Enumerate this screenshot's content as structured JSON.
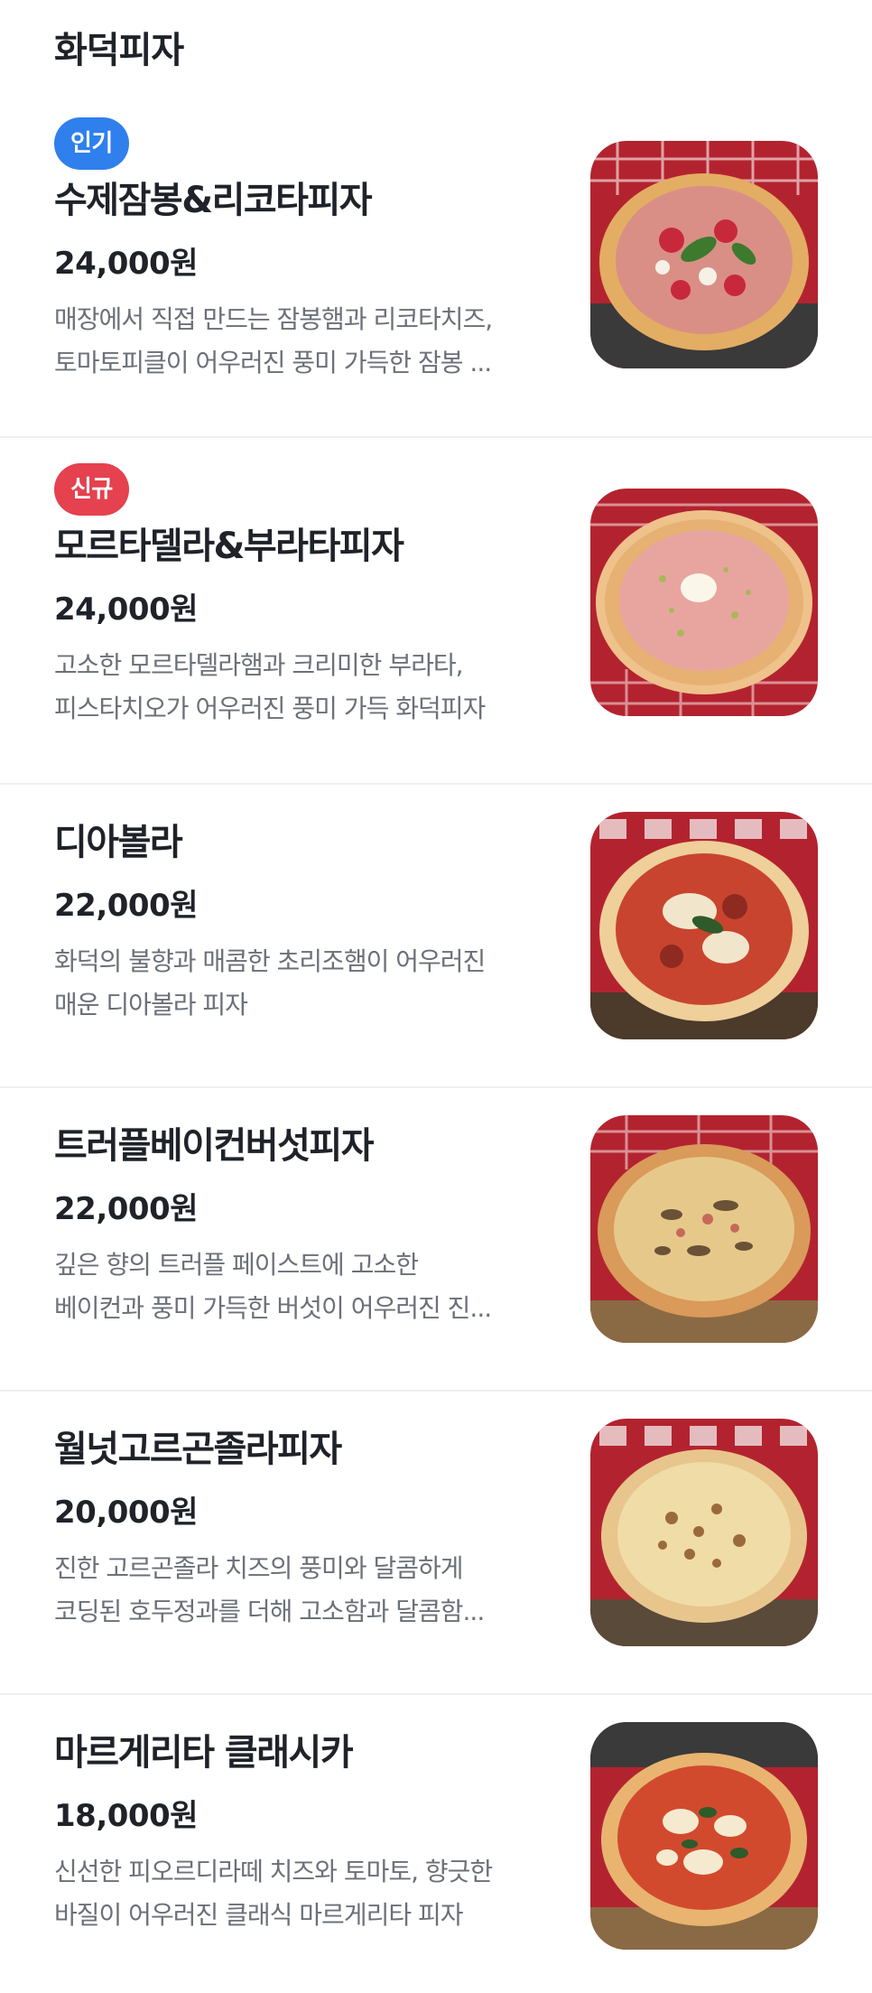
{
  "section": {
    "title": "화덕피자"
  },
  "colors": {
    "badge_popular": "#2f80ed",
    "badge_new": "#e5414f",
    "oven_red": "#b3232f",
    "crust": "#e9b46a",
    "sauce": "#c8442e",
    "cheese": "#f4e2b0"
  },
  "items": [
    {
      "badge": "인기",
      "badge_type": "popular",
      "name": "수제잠봉&리코타피자",
      "price": "24,000원",
      "desc_line1": "매장에서 직접 만드는 잠봉햄과 리코타치즈,",
      "desc_line2": "토마토피클이 어우러진 풍미 가득한 잠봉 ...",
      "image": "jambon-ricotta-pizza-photo"
    },
    {
      "badge": "신규",
      "badge_type": "new",
      "name": "모르타델라&부라타피자",
      "price": "24,000원",
      "desc_line1": "고소한 모르타델라햄과 크리미한 부라타,",
      "desc_line2": "피스타치오가 어우러진 풍미 가득 화덕피자",
      "image": "mortadella-burrata-pizza-photo"
    },
    {
      "badge": "",
      "badge_type": "",
      "name": "디아볼라",
      "price": "22,000원",
      "desc_line1": "화덕의 불향과 매콤한 초리조햄이 어우러진",
      "desc_line2": "매운 디아볼라 피자",
      "image": "diavola-pizza-photo"
    },
    {
      "badge": "",
      "badge_type": "",
      "name": "트러플베이컨버섯피자",
      "price": "22,000원",
      "desc_line1": "깊은 향의 트러플 페이스트에 고소한",
      "desc_line2": "베이컨과 풍미 가득한 버섯이 어우러진 진...",
      "image": "truffle-bacon-mushroom-pizza-photo"
    },
    {
      "badge": "",
      "badge_type": "",
      "name": "월넛고르곤졸라피자",
      "price": "20,000원",
      "desc_line1": "진한 고르곤졸라 치즈의 풍미와 달콤하게",
      "desc_line2": "코딩된 호두정과를 더해 고소함과 달콤함...",
      "image": "walnut-gorgonzola-pizza-photo"
    },
    {
      "badge": "",
      "badge_type": "",
      "name": "마르게리타 클래시카",
      "price": "18,000원",
      "desc_line1": "신선한 피오르디라떼 치즈와 토마토, 향긋한",
      "desc_line2": "바질이 어우러진 클래식 마르게리타 피자",
      "image": "margherita-classica-pizza-photo"
    }
  ]
}
